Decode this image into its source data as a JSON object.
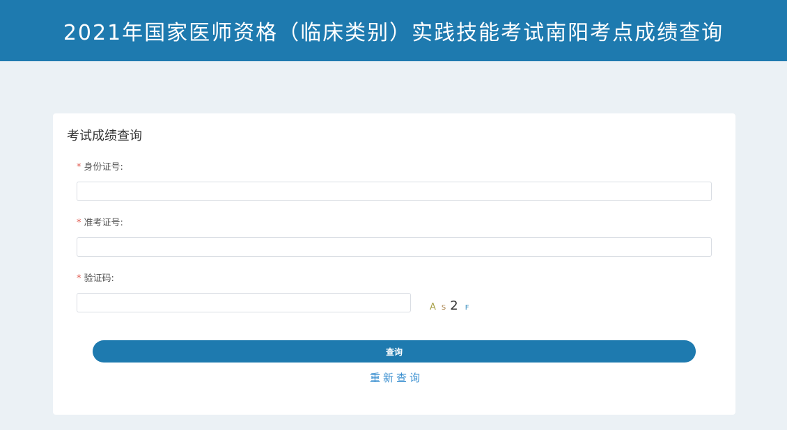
{
  "header": {
    "title": "2021年国家医师资格（临床类别）实践技能考试南阳考点成绩查询"
  },
  "form": {
    "title": "考试成绩查询",
    "required_mark": "*",
    "id_card": {
      "label": "身份证号:",
      "value": "",
      "placeholder": ""
    },
    "admission_no": {
      "label": "准考证号:",
      "value": "",
      "placeholder": ""
    },
    "captcha_code": {
      "label": "验证码:",
      "value": "",
      "placeholder": ""
    },
    "captcha_image": {
      "chars": [
        "A",
        "S",
        "2",
        "F"
      ],
      "colors": [
        "#a8a14a",
        "#a9844d",
        "#333333",
        "#3a8fbf"
      ]
    },
    "submit_label": "查询",
    "reset_label": "重新查询"
  },
  "colors": {
    "primary": "#1e7aaf",
    "page_background": "#ebf1f5",
    "required": "#e05a4f",
    "link": "#3a8fd0"
  }
}
